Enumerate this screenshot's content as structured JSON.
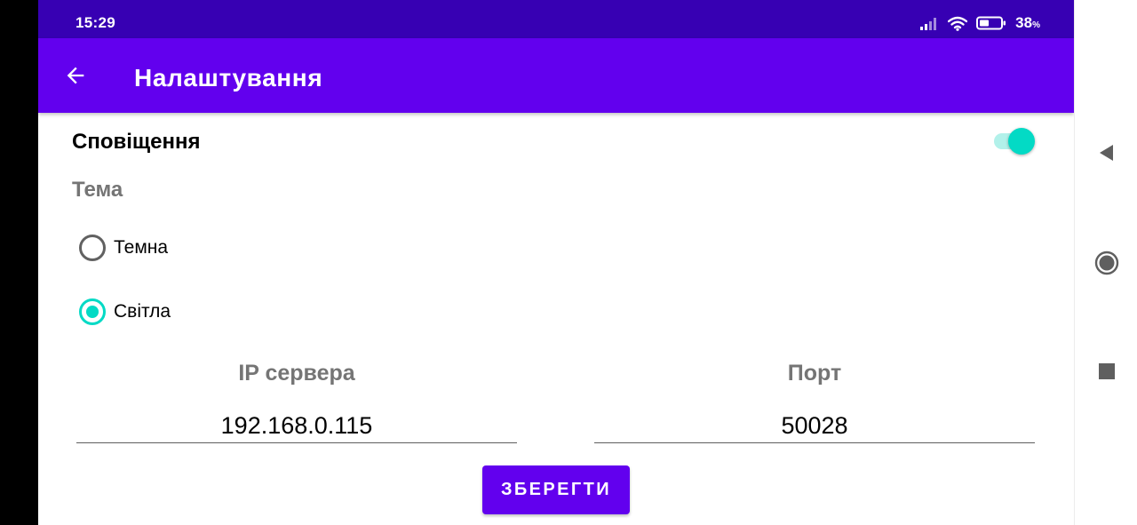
{
  "status_bar": {
    "time": "15:29",
    "battery_percent": "38",
    "battery_unit": "%",
    "icons": [
      "signal-icon",
      "wifi-icon",
      "battery-icon"
    ]
  },
  "app_bar": {
    "back_icon": "arrow-back-icon",
    "title": "Налаштування"
  },
  "settings": {
    "notifications_label": "Сповіщення",
    "notifications_enabled": true,
    "theme_label": "Тема",
    "theme_options": [
      {
        "label": "Темна",
        "selected": false
      },
      {
        "label": "Світла",
        "selected": true
      }
    ],
    "ip": {
      "label": "IP сервера",
      "value": "192.168.0.115"
    },
    "port": {
      "label": "Порт",
      "value": "50028"
    },
    "save_label": "ЗБЕРЕГТИ"
  },
  "nav_bar": {
    "icons": [
      "nav-back-icon",
      "nav-home-icon",
      "nav-recents-icon"
    ]
  },
  "colors": {
    "status_bar": "#3700b3",
    "primary": "#6200ee",
    "accent": "#03dac5",
    "secondary_text": "#757575"
  }
}
